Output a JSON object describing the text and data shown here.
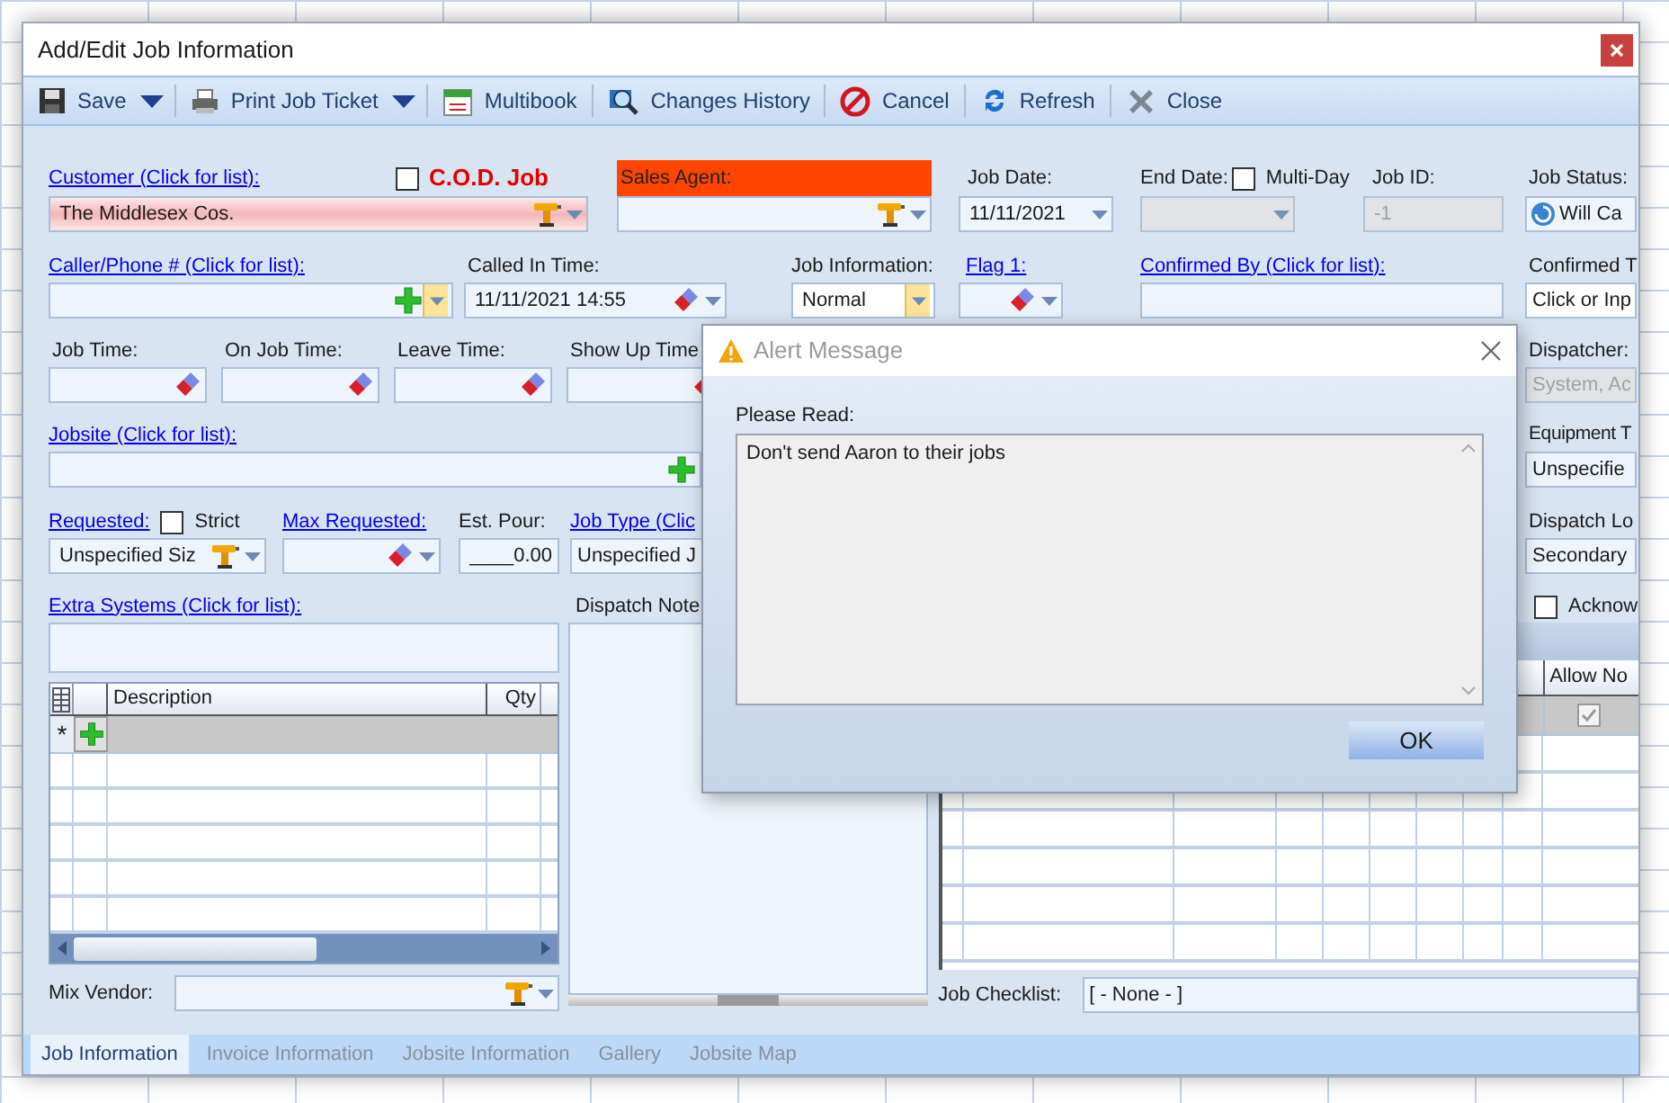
{
  "window": {
    "title": "Add/Edit Job Information"
  },
  "toolbar": [
    {
      "label": "Save",
      "kind": "save",
      "dropdown": true
    },
    {
      "label": "Print Job Ticket",
      "kind": "print",
      "dropdown": true
    },
    {
      "label": "Multibook",
      "kind": "calendar",
      "dropdown": false
    },
    {
      "label": "Changes History",
      "kind": "history",
      "dropdown": false
    },
    {
      "label": "Cancel",
      "kind": "cancel",
      "dropdown": false
    },
    {
      "label": "Refresh",
      "kind": "refresh",
      "dropdown": false
    },
    {
      "label": "Close",
      "kind": "close",
      "dropdown": false
    }
  ],
  "customer": {
    "label": "Customer (Click for list):",
    "value": "The Middlesex Cos."
  },
  "cod_job": {
    "label": "C.O.D. Job",
    "checked": false
  },
  "sales_agent": {
    "label": "Sales Agent:"
  },
  "job_date": {
    "label": "Job Date:",
    "value": "11/11/2021"
  },
  "end_date": {
    "label": "End Date:",
    "disabled": true
  },
  "multi_day": {
    "label": "Multi-Day",
    "checked": false
  },
  "job_id": {
    "label": "Job ID:",
    "value": "-1",
    "disabled": true
  },
  "job_status": {
    "label": "Job Status:",
    "value": "Will Ca"
  },
  "caller": {
    "label": "Caller/Phone # (Click for list):"
  },
  "called_in_time": {
    "label": "Called In Time:",
    "value": "11/11/2021 14:55"
  },
  "job_information": {
    "label": "Job Information:",
    "value": "Normal"
  },
  "flag_1": {
    "label": "Flag 1:"
  },
  "confirmed_by": {
    "label": "Confirmed By (Click for list):"
  },
  "confirmed_time": {
    "label": "Confirmed T",
    "value": "Click or Inp"
  },
  "times": [
    {
      "label": "Job Time:"
    },
    {
      "label": "On Job Time:"
    },
    {
      "label": "Leave Time:"
    },
    {
      "label": "Show Up Time"
    }
  ],
  "dispatcher": {
    "label": "Dispatcher:",
    "value": "System, Ac",
    "disabled": true
  },
  "jobsite": {
    "label": "Jobsite (Click for list):"
  },
  "equipment": {
    "label": "Equipment T",
    "value": "Unspecifie"
  },
  "requested": {
    "label": "Requested:",
    "value": "Unspecified Siz"
  },
  "strict": {
    "label": "Strict",
    "checked": false
  },
  "max_requested": {
    "label": "Max Requested:"
  },
  "est_pour": {
    "label": "Est. Pour:",
    "value": "____0.00"
  },
  "job_type": {
    "label": "Job Type (Clic",
    "value": "Unspecified J"
  },
  "dispatch_location": {
    "label": "Dispatch Lo",
    "value": "Secondary"
  },
  "acknowledge": {
    "label": "Acknow",
    "checked": false
  },
  "extra_systems": {
    "label": "Extra Systems (Click for list):"
  },
  "extra_table": {
    "columns": [
      "Description",
      "Qty"
    ],
    "new_row_marker": "*"
  },
  "dispatch_notes": {
    "label": "Dispatch Note"
  },
  "right_table": {
    "column": "Allow No",
    "new_row_checked": true
  },
  "mix_vendor": {
    "label": "Mix Vendor:"
  },
  "job_checklist": {
    "label": "Job Checklist:",
    "value": "[ - None - ]"
  },
  "tabs": [
    {
      "label": "Job Information",
      "selected": true
    },
    {
      "label": "Invoice Information",
      "selected": false
    },
    {
      "label": "Jobsite Information",
      "selected": false
    },
    {
      "label": "Gallery",
      "selected": false
    },
    {
      "label": "Jobsite Map",
      "selected": false
    }
  ],
  "alert": {
    "title": "Alert Message",
    "prompt": "Please Read:",
    "message": "Don't send Aaron to their jobs",
    "button": "OK"
  }
}
